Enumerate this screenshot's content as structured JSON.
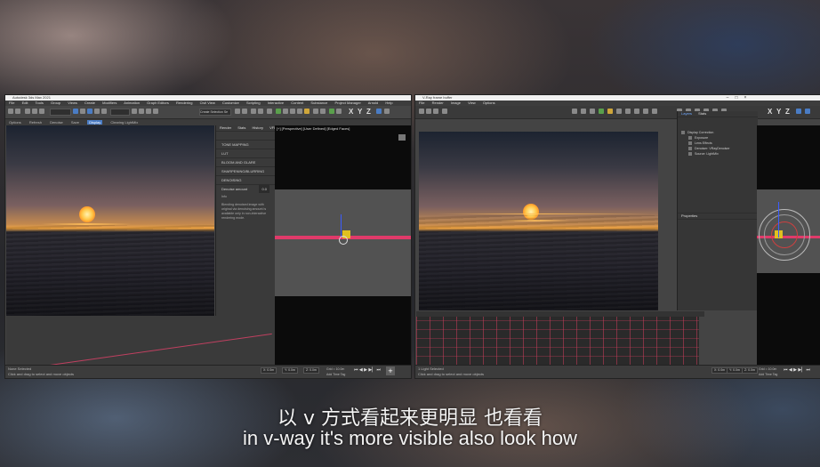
{
  "left_window": {
    "title": "Autodesk 3ds Max 2021",
    "menu": [
      "File",
      "Edit",
      "Tools",
      "Group",
      "Views",
      "Create",
      "Modifiers",
      "Animation",
      "Graph Editors",
      "Rendering",
      "Civil View",
      "Customize",
      "Scripting",
      "Interactive",
      "Content",
      "Substance",
      "Project Manager",
      "Arnold",
      "Help"
    ],
    "selection_set": "Create Selection Se",
    "axes": [
      "X",
      "Y",
      "Z"
    ],
    "subbar": [
      "Options",
      "Refresh",
      "Denoise",
      "Save",
      "Display",
      "Clearing LightMix"
    ],
    "viewport_label": "[+] [Perspective] [User Defined] [Edged Faces]",
    "panel_tabs": [
      "Render",
      "Stats",
      "History",
      "VFB",
      "LightMix"
    ],
    "sections": [
      "TONE MAPPING",
      "LUT",
      "BLOOM AND GLARE",
      "SHARPENING/BLURRING",
      "DENOISING"
    ],
    "denoise_label": "Denoise amount",
    "denoise_value": "0.0",
    "info_head": "Info",
    "info_text": "Blending denoised image with original via denoising amount is available only in non-interactive rendering mode.",
    "status_line1": "None Selected",
    "status_line2": "Click and drag to select and move objects",
    "coords": [
      "X: 0.0m",
      "Y: 0.0m",
      "Z: 0.0m"
    ],
    "grid_label": "Grid = 10.0m",
    "time_label": "Add Time Tag",
    "transport": "⏮ ◀ ▶ ▶▏ ⏭"
  },
  "right_window": {
    "title": "V-Ray frame buffer",
    "menu": [
      "File",
      "Render",
      "Image",
      "View",
      "Options"
    ],
    "layers_tabs": [
      "Layers",
      "Stats"
    ],
    "layers": [
      "Display Correction",
      "Exposure",
      "Lens Effects",
      "Denoiser: VRayDenoiser",
      "Source: LightMix"
    ],
    "properties_label": "Properties",
    "status_line1": "1 Light Selected",
    "status_line2": "Click and drag to select and move objects",
    "coords": [
      "X: 0.0m",
      "Y: 0.0m",
      "Z: 0.0m"
    ],
    "grid_label": "Grid = 10.0m",
    "time_label": "Add Time Tag",
    "transport": "⏮ ◀ ▶ ▶▏ ⏭"
  },
  "subtitles": {
    "chinese": "以 v 方式看起来更明显 也看看",
    "english": "in v-way it's more visible also look how"
  }
}
